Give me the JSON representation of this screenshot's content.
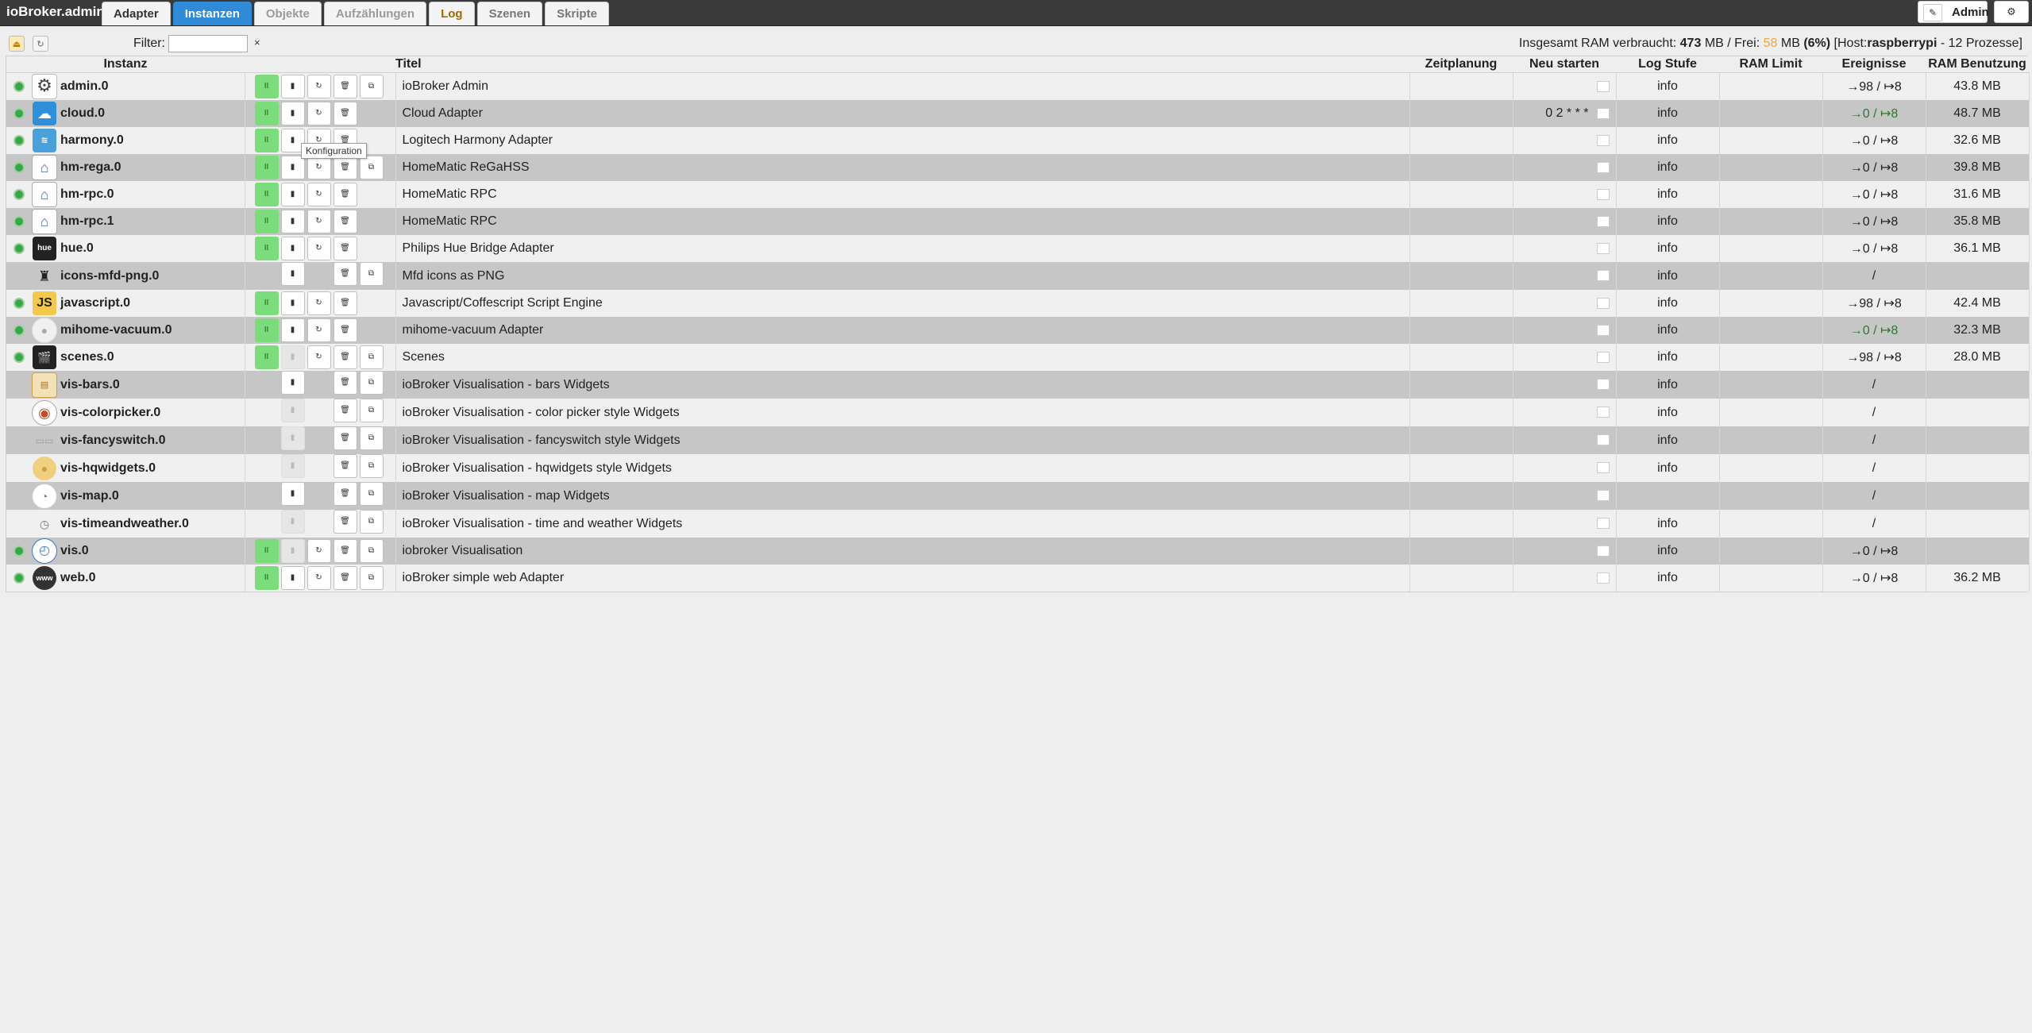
{
  "app_title": "ioBroker.admin",
  "tabs": [
    {
      "label": "Adapter",
      "state": "first"
    },
    {
      "label": "Instanzen",
      "state": "active"
    },
    {
      "label": "Objekte",
      "state": ""
    },
    {
      "label": "Aufzählungen",
      "state": ""
    },
    {
      "label": "Log",
      "state": "log"
    },
    {
      "label": "Szenen",
      "state": "dark"
    },
    {
      "label": "Skripte",
      "state": "dark"
    }
  ],
  "user_label": "Admin",
  "filter": {
    "label": "Filter:",
    "value": "",
    "clear": "×"
  },
  "ram": {
    "prefix": "Insgesamt RAM verbraucht:",
    "used": "473",
    "unit1": "MB / Frei:",
    "free": "58",
    "unit2": "MB",
    "percent": "(6%)",
    "host_prefix": "[Host:",
    "host": "raspberrypi",
    "host_suffix": "- 12 Prozesse]"
  },
  "columns": {
    "instance": "Instanz",
    "title": "Titel",
    "schedule": "Zeitplanung",
    "restart": "Neu starten",
    "loglevel": "Log Stufe",
    "ramlimit": "RAM Limit",
    "events": "Ereignisse",
    "ramusage": "RAM Benutzung"
  },
  "tooltip": "Konfiguration",
  "rows": [
    {
      "name": "admin.0",
      "title": "ioBroker Admin",
      "restart": "",
      "log": "info",
      "events": "→98 / ↦8",
      "events_green": false,
      "ram": "43.8 MB",
      "running": true,
      "icon": "gear",
      "buttons": [
        "run",
        "cfg",
        "reload",
        "del",
        "link"
      ]
    },
    {
      "name": "cloud.0",
      "title": "Cloud Adapter",
      "restart": "0 2 * * *",
      "log": "info",
      "events": "→0 / ↦8",
      "events_green": true,
      "ram": "48.7 MB",
      "running": true,
      "icon": "cloud",
      "buttons": [
        "run",
        "cfg",
        "reload",
        "del",
        "off"
      ]
    },
    {
      "name": "harmony.0",
      "title": "Logitech Harmony Adapter",
      "restart": "",
      "log": "info",
      "events": "→0 / ↦8",
      "events_green": false,
      "ram": "32.6 MB",
      "running": true,
      "icon": "harmony",
      "buttons": [
        "run",
        "cfg",
        "reload",
        "del",
        "off"
      ]
    },
    {
      "name": "hm-rega.0",
      "title": "HomeMatic ReGaHSS",
      "restart": "",
      "log": "info",
      "events": "→0 / ↦8",
      "events_green": false,
      "ram": "39.8 MB",
      "running": true,
      "icon": "hm",
      "buttons": [
        "run",
        "cfg",
        "reload",
        "del",
        "link"
      ]
    },
    {
      "name": "hm-rpc.0",
      "title": "HomeMatic RPC",
      "restart": "",
      "log": "info",
      "events": "→0 / ↦8",
      "events_green": false,
      "ram": "31.6 MB",
      "running": true,
      "icon": "hm",
      "buttons": [
        "run",
        "cfg",
        "reload",
        "del",
        "off"
      ]
    },
    {
      "name": "hm-rpc.1",
      "title": "HomeMatic RPC",
      "restart": "",
      "log": "info",
      "events": "→0 / ↦8",
      "events_green": false,
      "ram": "35.8 MB",
      "running": true,
      "icon": "hm",
      "buttons": [
        "run",
        "cfg",
        "reload",
        "del",
        "off"
      ]
    },
    {
      "name": "hue.0",
      "title": "Philips Hue Bridge Adapter",
      "restart": "",
      "log": "info",
      "events": "→0 / ↦8",
      "events_green": false,
      "ram": "36.1 MB",
      "running": true,
      "icon": "hue",
      "buttons": [
        "run",
        "cfg",
        "reload",
        "del",
        "off"
      ]
    },
    {
      "name": "icons-mfd-png.0",
      "title": "Mfd icons as PNG",
      "restart": "",
      "log": "info",
      "events": "/",
      "events_green": false,
      "ram": "",
      "running": false,
      "icon": "mfd",
      "buttons": [
        "off",
        "cfg",
        "off",
        "del",
        "link"
      ]
    },
    {
      "name": "javascript.0",
      "title": "Javascript/Coffescript Script Engine",
      "restart": "",
      "log": "info",
      "events": "→98 / ↦8",
      "events_green": false,
      "ram": "42.4 MB",
      "running": true,
      "icon": "js",
      "buttons": [
        "run",
        "cfg",
        "reload",
        "del",
        "off"
      ]
    },
    {
      "name": "mihome-vacuum.0",
      "title": "mihome-vacuum Adapter",
      "restart": "",
      "log": "info",
      "events": "→0 / ↦8",
      "events_green": true,
      "ram": "32.3 MB",
      "running": true,
      "icon": "vacuum",
      "buttons": [
        "run",
        "cfg",
        "reload",
        "del",
        "off"
      ]
    },
    {
      "name": "scenes.0",
      "title": "Scenes",
      "restart": "",
      "log": "info",
      "events": "→98 / ↦8",
      "events_green": false,
      "ram": "28.0 MB",
      "running": true,
      "icon": "scenes",
      "buttons": [
        "run",
        "gray",
        "reload",
        "del",
        "link"
      ]
    },
    {
      "name": "vis-bars.0",
      "title": "ioBroker Visualisation - bars Widgets",
      "restart": "",
      "log": "info",
      "events": "/",
      "events_green": false,
      "ram": "",
      "running": false,
      "icon": "bars",
      "buttons": [
        "off",
        "cfg",
        "off",
        "del",
        "link"
      ]
    },
    {
      "name": "vis-colorpicker.0",
      "title": "ioBroker Visualisation - color picker style Widgets",
      "restart": "",
      "log": "info",
      "events": "/",
      "events_green": false,
      "ram": "",
      "running": false,
      "icon": "colorpicker",
      "buttons": [
        "off",
        "gray",
        "off",
        "del",
        "link"
      ]
    },
    {
      "name": "vis-fancyswitch.0",
      "title": "ioBroker Visualisation - fancyswitch style Widgets",
      "restart": "",
      "log": "info",
      "events": "/",
      "events_green": false,
      "ram": "",
      "running": false,
      "icon": "fancy",
      "buttons": [
        "off",
        "gray",
        "off",
        "del",
        "link"
      ]
    },
    {
      "name": "vis-hqwidgets.0",
      "title": "ioBroker Visualisation - hqwidgets style Widgets",
      "restart": "",
      "log": "info",
      "events": "/",
      "events_green": false,
      "ram": "",
      "running": false,
      "icon": "hq",
      "buttons": [
        "off",
        "gray",
        "off",
        "del",
        "link"
      ]
    },
    {
      "name": "vis-map.0",
      "title": "ioBroker Visualisation - map Widgets",
      "restart": "",
      "log": "",
      "events": "/",
      "events_green": false,
      "ram": "",
      "running": false,
      "icon": "map",
      "buttons": [
        "off",
        "cfg",
        "off",
        "del",
        "link"
      ]
    },
    {
      "name": "vis-timeandweather.0",
      "title": "ioBroker Visualisation - time and weather Widgets",
      "restart": "",
      "log": "info",
      "events": "/",
      "events_green": false,
      "ram": "",
      "running": false,
      "icon": "time",
      "buttons": [
        "off",
        "gray",
        "off",
        "del",
        "link"
      ]
    },
    {
      "name": "vis.0",
      "title": "iobroker Visualisation",
      "restart": "",
      "log": "info",
      "events": "→0 / ↦8",
      "events_green": false,
      "ram": "",
      "running": true,
      "icon": "vis",
      "buttons": [
        "run",
        "gray",
        "reload",
        "del",
        "link"
      ]
    },
    {
      "name": "web.0",
      "title": "ioBroker simple web Adapter",
      "restart": "",
      "log": "info",
      "events": "→0 / ↦8",
      "events_green": false,
      "ram": "36.2 MB",
      "running": true,
      "icon": "web",
      "buttons": [
        "run",
        "cfg",
        "reload",
        "del",
        "link"
      ]
    }
  ]
}
